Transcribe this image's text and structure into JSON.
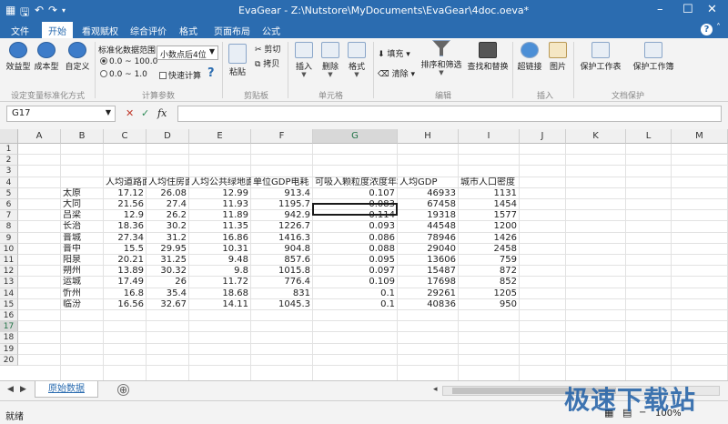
{
  "titlebar": {
    "app": "EvaGear",
    "title": "EvaGear  -  Z:\\Nutstore\\MyDocuments\\EvaGear\\4doc.oeva*"
  },
  "menubar": {
    "tabs": [
      "文件",
      "开始",
      "看观赋权",
      "综合评价",
      "格式",
      "页面布局",
      "公式"
    ],
    "active": "开始"
  },
  "ribbon": {
    "buttons": {
      "benefit": "效益型",
      "cost": "成本型",
      "custom": "自定义",
      "paste": "粘贴",
      "cut": "剪切",
      "copy": "拷贝",
      "insert": "插入",
      "delete": "删除",
      "format": "格式",
      "fill": "填充",
      "clear": "清除",
      "sort": "排序和筛选",
      "find": "查找和替换",
      "hyperlink": "超链接",
      "picture": "图片",
      "protect_sheet": "保护工作表",
      "protect_book": "保护工作簿"
    },
    "std_range_label": "标准化数据范围",
    "radio1": "0.0 ~ 100.0",
    "radio2": "0.0 ~ 1.0",
    "decimal_select": "小数点后4位",
    "quick_calc": "快速计算",
    "groups": {
      "g1": "设定变量标准化方式",
      "g2": "计算参数",
      "g3": "剪贴板",
      "g4": "单元格",
      "g5": "编辑",
      "g6": "插入",
      "g7": "文档保护"
    }
  },
  "formula": {
    "namebox": "G17",
    "fx": "fx",
    "content": ""
  },
  "columns": [
    "A",
    "B",
    "C",
    "D",
    "E",
    "F",
    "G",
    "H",
    "I",
    "J",
    "K",
    "L",
    "M"
  ],
  "rows": [
    "1",
    "2",
    "3",
    "4",
    "5",
    "6",
    "7",
    "8",
    "9",
    "10",
    "11",
    "12",
    "13",
    "14",
    "15",
    "16",
    "17",
    "18",
    "19",
    "20"
  ],
  "headers": [
    "人均道路面积",
    "人均住房面积",
    "人均公共绿地面积",
    "单位GDP电耗",
    "可吸入颗粒度浓度年均值",
    "人均GDP",
    "城市人口密度"
  ],
  "table": [
    {
      "city": "太原",
      "c": "17.12",
      "d": "26.08",
      "e": "12.99",
      "f": "913.4",
      "g": "0.107",
      "h": "46933",
      "i": "1131"
    },
    {
      "city": "大同",
      "c": "21.56",
      "d": "27.4",
      "e": "11.93",
      "f": "1195.7",
      "g": "0.083",
      "h": "67458",
      "i": "1454"
    },
    {
      "city": "吕梁",
      "c": "12.9",
      "d": "26.2",
      "e": "11.89",
      "f": "942.9",
      "g": "0.114",
      "h": "19318",
      "i": "1577"
    },
    {
      "city": "长治",
      "c": "18.36",
      "d": "30.2",
      "e": "11.35",
      "f": "1226.7",
      "g": "0.093",
      "h": "44548",
      "i": "1200"
    },
    {
      "city": "晋城",
      "c": "27.34",
      "d": "31.2",
      "e": "16.86",
      "f": "1416.3",
      "g": "0.086",
      "h": "78946",
      "i": "1426"
    },
    {
      "city": "晋中",
      "c": "15.5",
      "d": "29.95",
      "e": "10.31",
      "f": "904.8",
      "g": "0.088",
      "h": "29040",
      "i": "2458"
    },
    {
      "city": "阳泉",
      "c": "20.21",
      "d": "31.25",
      "e": "9.48",
      "f": "857.6",
      "g": "0.095",
      "h": "13606",
      "i": "759"
    },
    {
      "city": "朔州",
      "c": "13.89",
      "d": "30.32",
      "e": "9.8",
      "f": "1015.8",
      "g": "0.097",
      "h": "15487",
      "i": "872"
    },
    {
      "city": "运城",
      "c": "17.49",
      "d": "26",
      "e": "11.72",
      "f": "776.4",
      "g": "0.109",
      "h": "17698",
      "i": "852"
    },
    {
      "city": "忻州",
      "c": "16.8",
      "d": "35.4",
      "e": "18.68",
      "f": "831",
      "g": "0.1",
      "h": "29261",
      "i": "1205"
    },
    {
      "city": "临汾",
      "c": "16.56",
      "d": "32.67",
      "e": "14.11",
      "f": "1045.3",
      "g": "0.1",
      "h": "40836",
      "i": "950"
    }
  ],
  "sheet": {
    "tab": "原始数据",
    "add": "⊕"
  },
  "status": {
    "ready": "就绪",
    "zoom": "100%"
  },
  "watermark": "极速下载站"
}
